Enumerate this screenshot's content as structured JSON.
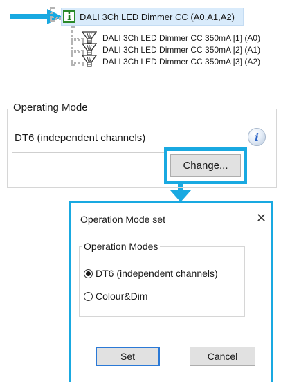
{
  "colors": {
    "highlight_cyan": "#19a9e1",
    "tree_selection": "#d9ebfb",
    "info_icon_green": "#2a8a2a",
    "default_button_border": "#2b79d6"
  },
  "tree": {
    "root": {
      "icon": "info-green-icon",
      "label": "DALI 3Ch LED Dimmer CC (A0,A1,A2)"
    },
    "children": [
      {
        "icon": "lamp-icon",
        "label": "DALI 3Ch LED Dimmer CC 350mA [1] (A0)"
      },
      {
        "icon": "lamp-icon",
        "label": "DALI 3Ch LED Dimmer CC 350mA [2] (A1)"
      },
      {
        "icon": "lamp-icon",
        "label": "DALI 3Ch LED Dimmer CC 350mA [3] (A2)"
      }
    ]
  },
  "operating_mode": {
    "legend": "Operating Mode",
    "value": "DT6 (independent channels)",
    "info_icon": "info-circle-icon",
    "change_button": "Change..."
  },
  "dialog": {
    "title": "Operation Mode set",
    "close_glyph": "✕",
    "group_label": "Operation Modes",
    "options": [
      {
        "label": "DT6 (independent channels)",
        "checked": true
      },
      {
        "label": "Colour&Dim",
        "checked": false
      }
    ],
    "set_button": "Set",
    "cancel_button": "Cancel"
  }
}
